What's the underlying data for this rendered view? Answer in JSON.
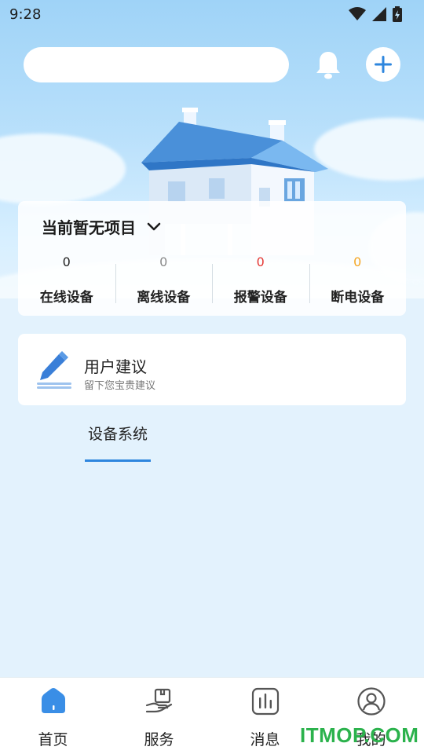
{
  "status_bar": {
    "time": "9:28"
  },
  "header": {
    "search_placeholder": ""
  },
  "project": {
    "title": "当前暂无项目",
    "stats": [
      {
        "value": "0",
        "label": "在线设备",
        "color": "#222222"
      },
      {
        "value": "0",
        "label": "离线设备",
        "color": "#8a8a8a"
      },
      {
        "value": "0",
        "label": "报警设备",
        "color": "#e53935"
      },
      {
        "value": "0",
        "label": "断电设备",
        "color": "#f5a623"
      }
    ]
  },
  "suggestion": {
    "title": "用户建议",
    "subtitle": "留下您宝贵建议"
  },
  "tabs": {
    "device_system": "设备系统"
  },
  "bottom_nav": [
    {
      "label": "首页",
      "icon": "home-icon"
    },
    {
      "label": "服务",
      "icon": "service-icon"
    },
    {
      "label": "消息",
      "icon": "message-icon"
    },
    {
      "label": "我的",
      "icon": "user-icon"
    }
  ],
  "watermark": "ITMOP.COM",
  "colors": {
    "accent": "#2e86de",
    "alarm": "#e53935",
    "power": "#f5a623",
    "offline": "#8a8a8a"
  }
}
